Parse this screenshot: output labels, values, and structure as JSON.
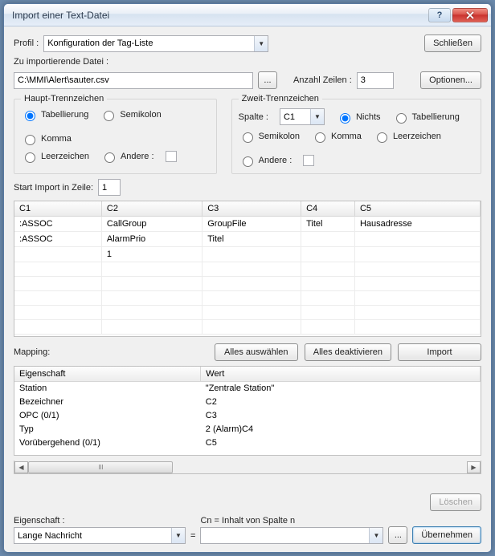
{
  "window": {
    "title": "Import einer Text-Datei"
  },
  "profile": {
    "label": "Profil :",
    "value": "Konfiguration der Tag-Liste"
  },
  "close_btn": "Schließen",
  "file": {
    "label": "Zu importierende Datei :",
    "path": "C:\\MMI\\Alert\\sauter.csv",
    "browse": "...",
    "lines_label": "Anzahl Zeilen :",
    "lines_value": "3",
    "options_btn": "Optionen..."
  },
  "sep1": {
    "legend": "Haupt-Trennzeichen",
    "tab": "Tabellierung",
    "semicolon": "Semikolon",
    "comma": "Komma",
    "space": "Leerzeichen",
    "other": "Andere :"
  },
  "sep2": {
    "legend": "Zweit-Trennzeichen",
    "column_label": "Spalte :",
    "column_value": "C1",
    "none": "Nichts",
    "tab": "Tabellierung",
    "semicolon": "Semikolon",
    "comma": "Komma",
    "space": "Leerzeichen",
    "other": "Andere :"
  },
  "start_line": {
    "label": "Start Import in Zeile:",
    "value": "1"
  },
  "preview": {
    "cols": [
      "C1",
      "C2",
      "C3",
      "C4",
      "C5"
    ],
    "rows": [
      [
        ":ASSOC",
        "CallGroup",
        "GroupFile",
        "Titel",
        "Hausadresse"
      ],
      [
        ":ASSOC",
        "AlarmPrio",
        "Titel",
        "",
        ""
      ],
      [
        "",
        "1",
        "",
        "",
        ""
      ]
    ]
  },
  "mapping": {
    "label": "Mapping:",
    "select_all": "Alles auswählen",
    "deselect_all": "Alles deaktivieren",
    "import": "Import",
    "col_prop": "Eigenschaft",
    "col_val": "Wert",
    "rows": [
      {
        "prop": "Station",
        "val": "\"Zentrale Station\""
      },
      {
        "prop": "Bezeichner",
        "val": "C2"
      },
      {
        "prop": "OPC (0/1)",
        "val": "C3"
      },
      {
        "prop": "Typ",
        "val": "2 (Alarm)C4"
      },
      {
        "prop": "Vorübergehend (0/1)",
        "val": "C5"
      }
    ]
  },
  "delete_btn": "Löschen",
  "formula": {
    "prop_label": "Eigenschaft :",
    "prop_value": "Lange Nachricht",
    "hint": "Cn = Inhalt von Spalte n",
    "equals": "=",
    "value": "",
    "browse": "...",
    "apply": "Übernehmen"
  }
}
